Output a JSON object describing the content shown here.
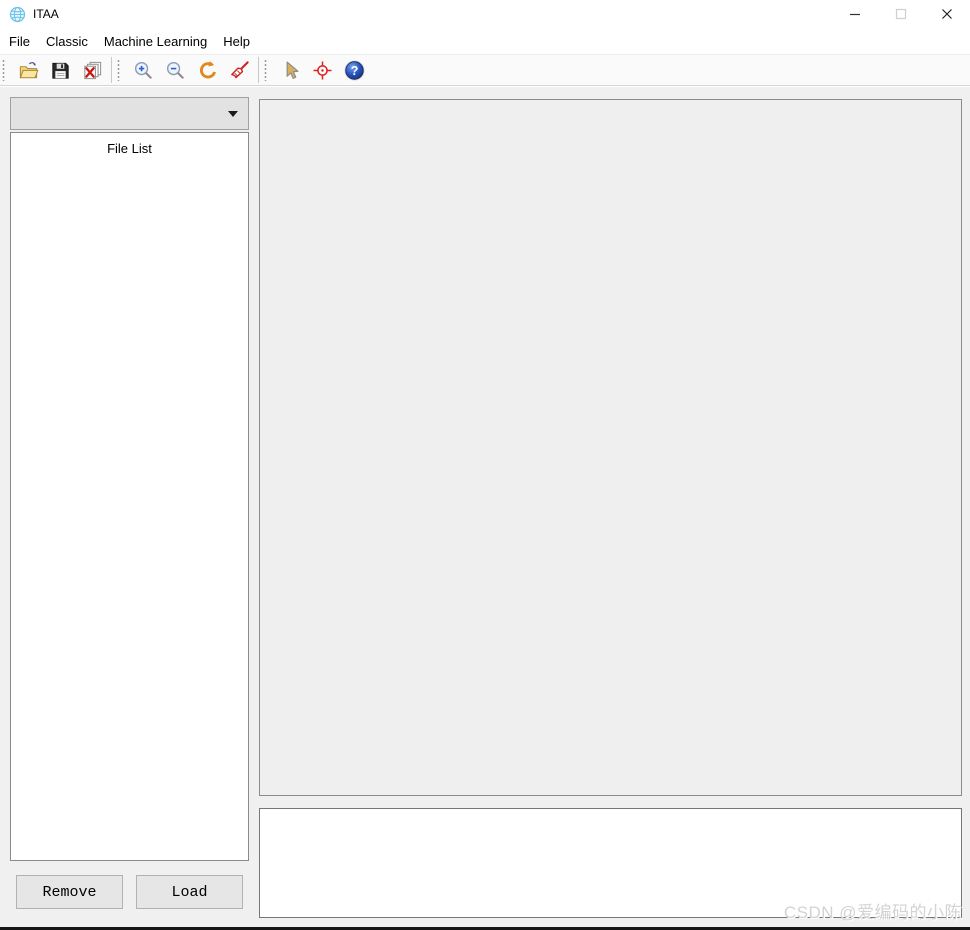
{
  "window": {
    "title": "ITAA"
  },
  "menu": {
    "items": [
      "File",
      "Classic",
      "Machine Learning",
      "Help"
    ]
  },
  "toolbar": {
    "groups": [
      {
        "icons": [
          "open-file-icon",
          "save-icon",
          "close-images-icon"
        ]
      },
      {
        "icons": [
          "zoom-in-icon",
          "zoom-out-icon",
          "reset-view-icon",
          "clear-brush-icon"
        ]
      },
      {
        "icons": [
          "pointer-tool-icon",
          "crosshair-tool-icon",
          "help-icon"
        ]
      }
    ]
  },
  "sidebar": {
    "combo_value": "",
    "file_list_title": "File List",
    "remove_button": "Remove",
    "load_button": "Load"
  },
  "watermark": "CSDN @爱编码的小陈",
  "colors": {
    "client_bg": "#f0f0f0",
    "panel_bg": "#efefef",
    "danger_red": "#cc2222",
    "help_blue": "#2a55c0",
    "folder_yellow": "#f2d57e",
    "globe_blue": "#6ec3e8"
  }
}
